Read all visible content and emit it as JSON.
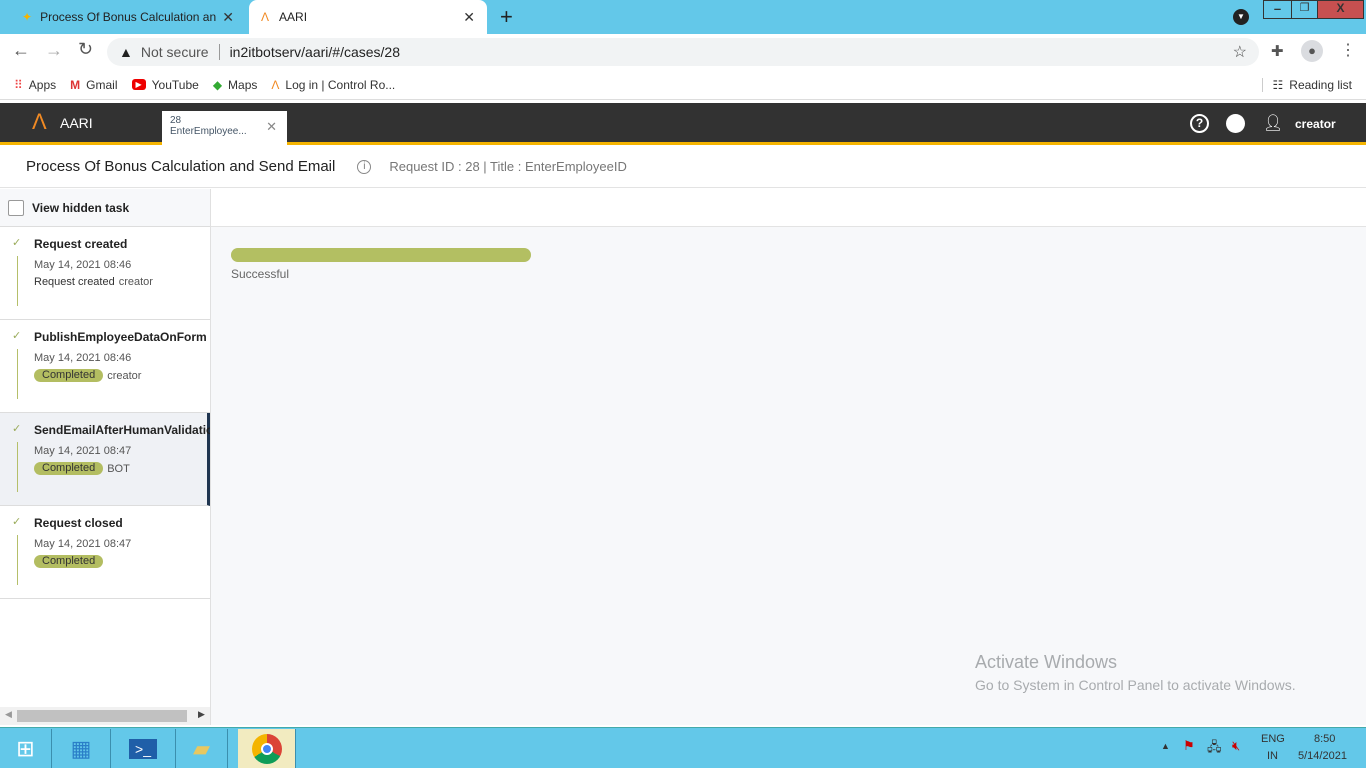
{
  "browser": {
    "tabs": [
      {
        "title": "Process Of Bonus Calculation and Send Email"
      },
      {
        "title": "AARI"
      }
    ],
    "new_tab": "+",
    "security": "Not secure",
    "url": "in2itbotserv/aari/#/cases/28",
    "bookmarks": [
      "Apps",
      "Gmail",
      "YouTube",
      "Maps",
      "Log in | Control Ro..."
    ],
    "reading_list": "Reading list"
  },
  "app": {
    "name": "AARI",
    "open_tab": {
      "id": "28",
      "title": "EnterEmployee..."
    },
    "user": "creator"
  },
  "header": {
    "title": "Process Of Bonus Calculation and Send Email",
    "meta": "Request ID : 28 | Title : EnterEmployeeID"
  },
  "sidebar": {
    "view_hidden": "View hidden task",
    "items": [
      {
        "name": "Request created",
        "date": "May 14, 2021 08:46",
        "status": "Request created",
        "actor": "creator",
        "badge": false
      },
      {
        "name": "PublishEmployeeDataOnForm",
        "date": "May 14, 2021 08:46",
        "status": "Completed",
        "actor": "creator",
        "badge": true
      },
      {
        "name": "SendEmailAfterHumanValidation",
        "date": "May 14, 2021 08:47",
        "status": "Completed",
        "actor": "BOT",
        "badge": true
      },
      {
        "name": "Request closed",
        "date": "May 14, 2021 08:47",
        "status": "Completed",
        "actor": "",
        "badge": true
      }
    ]
  },
  "main": {
    "progress_percent": 100,
    "progress_label": "Successful",
    "progress_color": "#b3bf62"
  },
  "watermark": {
    "title": "Activate Windows",
    "sub": "Go to System in Control Panel to activate Windows."
  },
  "taskbar": {
    "lang1": "ENG",
    "lang2": "IN",
    "time": "8:50",
    "date": "5/14/2021"
  }
}
